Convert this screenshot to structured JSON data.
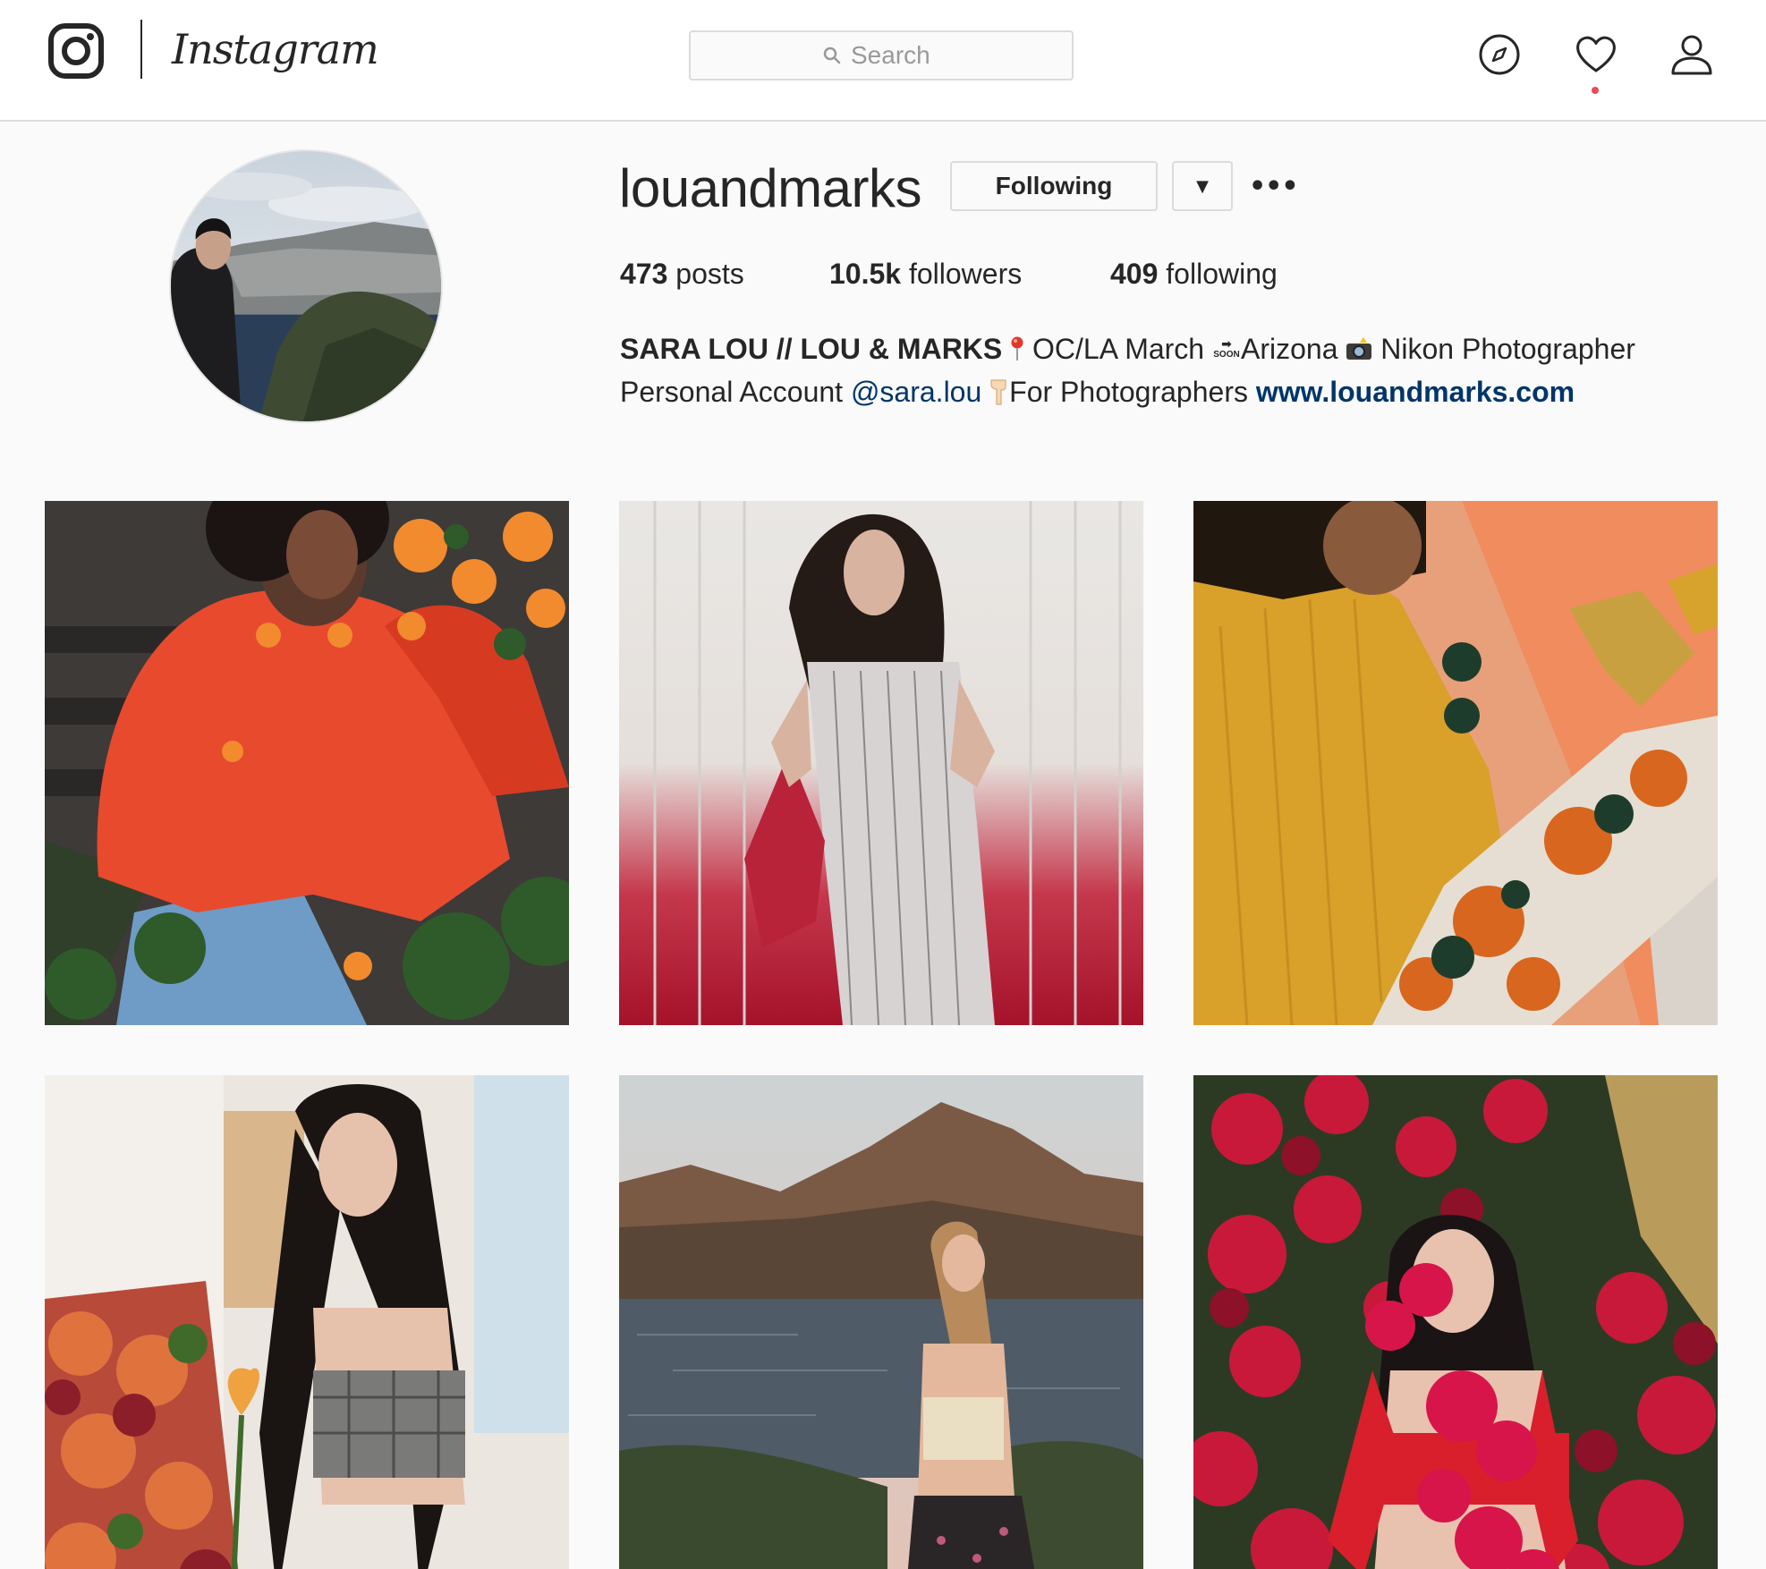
{
  "header": {
    "wordmark": "Instagram",
    "search": {
      "placeholder": "Search"
    },
    "nav_icons": [
      "compass-icon",
      "heart-icon",
      "person-icon"
    ],
    "activity_dot_color": "#ed4956"
  },
  "profile": {
    "username": "louandmarks",
    "following_button": "Following",
    "dropdown_glyph": "▼",
    "more_glyph": "•••",
    "stats": {
      "posts_count": "473",
      "posts_label": "posts",
      "followers_count": "10.5k",
      "followers_label": "followers",
      "following_count": "409",
      "following_label": "following"
    },
    "bio": {
      "name": "SARA LOU // LOU & MARKS",
      "location": "OC/LA March",
      "soon_badge": "SOON",
      "destination": "Arizona",
      "role": "Nikon Photographer",
      "personal_prefix": "Personal Account",
      "mention": "@sara.lou",
      "for_text": "For Photographers",
      "website": "www.louandmarks.com"
    }
  },
  "posts": [
    {
      "name": "post-red-sweater-flowers"
    },
    {
      "name": "post-striped-jumpsuit-red-wall"
    },
    {
      "name": "post-mustard-top-floral-pants"
    },
    {
      "name": "post-plaid-top-flower-shop"
    },
    {
      "name": "post-lake-mountain-portrait"
    },
    {
      "name": "post-bougainvillea-portrait"
    }
  ],
  "colors": {
    "link": "#003569",
    "border": "#dbdbdb",
    "background": "#fafafa",
    "text": "#262626"
  }
}
